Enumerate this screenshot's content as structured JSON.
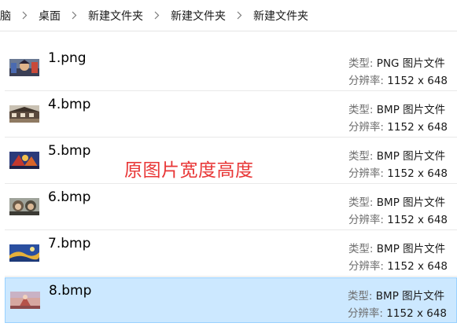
{
  "breadcrumb": [
    "脑",
    "桌面",
    "新建文件夹",
    "新建文件夹",
    "新建文件夹"
  ],
  "labels": {
    "type": "类型:",
    "resolution": "分辨率:"
  },
  "files": [
    {
      "name": "1.png",
      "type": "PNG 图片文件",
      "resolution": "1152 x 648"
    },
    {
      "name": "4.bmp",
      "type": "BMP 图片文件",
      "resolution": "1152 x 648"
    },
    {
      "name": "5.bmp",
      "type": "BMP 图片文件",
      "resolution": "1152 x 648"
    },
    {
      "name": "6.bmp",
      "type": "BMP 图片文件",
      "resolution": "1152 x 648"
    },
    {
      "name": "7.bmp",
      "type": "BMP 图片文件",
      "resolution": "1152 x 648"
    },
    {
      "name": "8.bmp",
      "type": "BMP 图片文件",
      "resolution": "1152 x 648"
    }
  ],
  "selected_file": "8.bmp",
  "overlay_text": "原图片宽度高度",
  "colors": {
    "selection_bg": "#cce8ff",
    "selection_border": "#99d1ff",
    "overlay": "#e83636"
  }
}
